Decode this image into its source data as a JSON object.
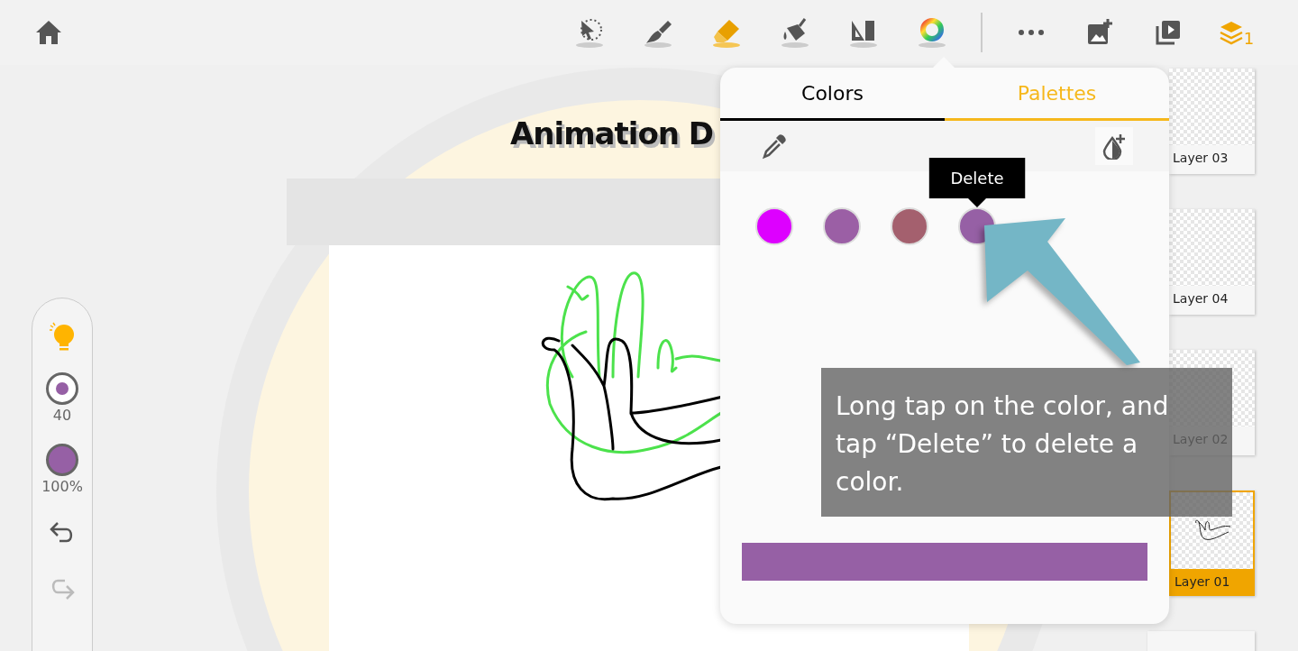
{
  "toolbar": {
    "tools": [
      {
        "kind": "select",
        "selected": false
      },
      {
        "kind": "brush",
        "selected": false
      },
      {
        "kind": "eraser",
        "selected": true
      },
      {
        "kind": "fill",
        "selected": false
      },
      {
        "kind": "ruler",
        "selected": false
      },
      {
        "kind": "color",
        "selected": false
      }
    ],
    "layers_button": {
      "count": "1",
      "on": true
    }
  },
  "side_panel": {
    "brush_size": "40",
    "opacity": "100%",
    "redo_disabled": true
  },
  "canvas": {
    "logo": "Animation D"
  },
  "color_popover": {
    "tabs": [
      {
        "label": "Colors",
        "selected": true
      },
      {
        "label": "Palettes",
        "selected": false
      }
    ],
    "swatches": [
      {
        "color": "#dd00ff"
      },
      {
        "color": "#9b5fa5"
      },
      {
        "color": "#a4606e"
      },
      {
        "color": "#9660a5",
        "tooltip": "Delete"
      }
    ]
  },
  "callout": {
    "text": "Long tap on the color, and tap “Delete” to delete a color."
  },
  "layers": [
    {
      "name": "Layer 03",
      "selected": false,
      "kind": "empty"
    },
    {
      "name": "Layer 04",
      "selected": false,
      "kind": "empty"
    },
    {
      "name": "Layer 02",
      "selected": false,
      "kind": "empty"
    },
    {
      "name": "Layer 01",
      "selected": true,
      "kind": "sketch"
    }
  ]
}
